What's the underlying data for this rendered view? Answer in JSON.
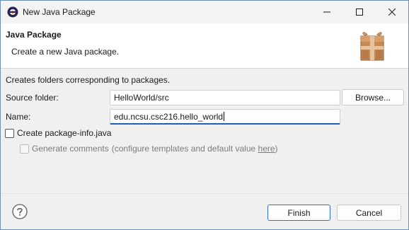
{
  "window": {
    "title": "New Java Package"
  },
  "banner": {
    "title": "Java Package",
    "description": "Create a new Java package."
  },
  "body": {
    "info": "Creates folders corresponding to packages.",
    "source_folder": {
      "label": "Source folder:",
      "value": "HelloWorld/src",
      "browse_label": "Browse..."
    },
    "name": {
      "label": "Name:",
      "value": "edu.ncsu.csc216.hello_world"
    },
    "create_package_info": {
      "label": "Create package-info.java",
      "checked": false
    },
    "generate_comments": {
      "label": "Generate comments",
      "hint_prefix": "(configure templates and default value ",
      "link": "here",
      "hint_suffix": ")",
      "checked": false,
      "enabled": false
    }
  },
  "footer": {
    "finish_label": "Finish",
    "cancel_label": "Cancel"
  },
  "icons": {
    "app": "java-package-icon",
    "banner": "package-box-icon",
    "help": "help-icon",
    "minimize": "minimize-icon",
    "maximize": "maximize-icon",
    "close": "close-icon"
  },
  "colors": {
    "focus_accent": "#1f5fb4",
    "default_button_border": "#2f6fcf"
  }
}
